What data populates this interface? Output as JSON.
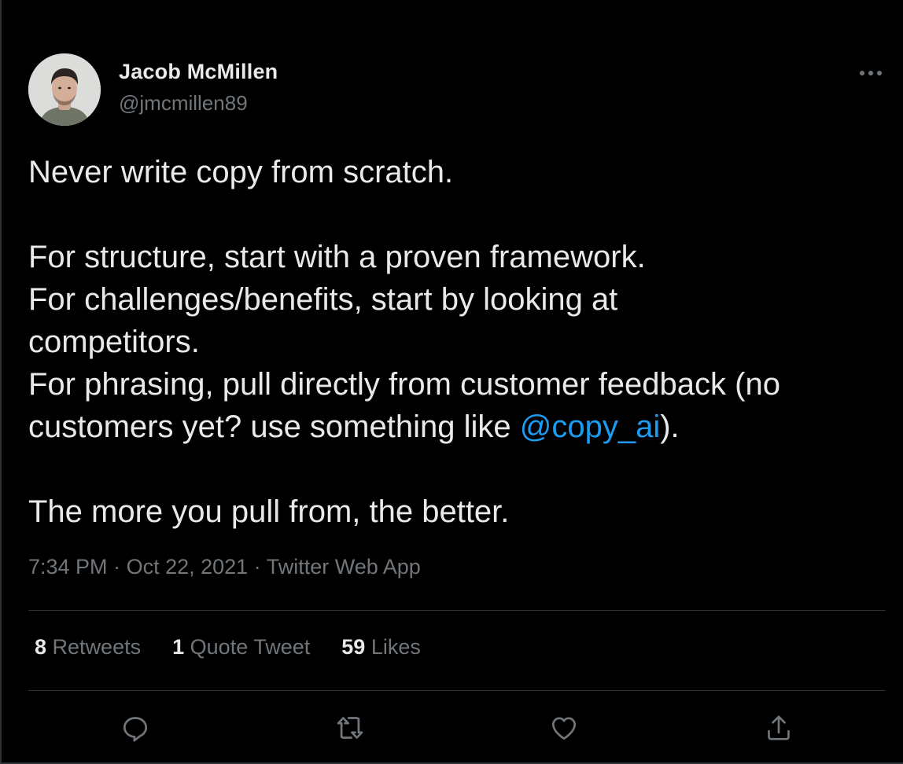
{
  "author": {
    "display_name": "Jacob McMillen",
    "handle": "@jmcmillen89"
  },
  "tweet": {
    "lines": {
      "l1": "Never write copy from scratch.",
      "l2": "For structure, start with a proven framework.",
      "l3": "For challenges/benefits, start by looking at",
      "l4": "competitors.",
      "l5a": "For phrasing, pull directly from customer feedback (no",
      "l6_pre": "customers yet? use something like ",
      "l6_mention": "@copy_ai",
      "l6_post": ").",
      "l7": "The more you pull from, the better."
    }
  },
  "meta": {
    "time": "7:34 PM",
    "sep1": " · ",
    "date": "Oct 22, 2021",
    "sep2": " · ",
    "source": "Twitter Web App"
  },
  "stats": {
    "retweets_count": "8",
    "retweets_label": "Retweets",
    "quotes_count": "1",
    "quotes_label": "Quote Tweet",
    "likes_count": "59",
    "likes_label": "Likes"
  },
  "icons": {
    "more": "more-horizontal-icon",
    "reply": "reply-icon",
    "retweet": "retweet-icon",
    "like": "heart-icon",
    "share": "share-icon"
  },
  "colors": {
    "background": "#000000",
    "text": "#e7e9ea",
    "secondary": "#71767b",
    "accent": "#1d9bf0",
    "divider": "#2f3336"
  }
}
